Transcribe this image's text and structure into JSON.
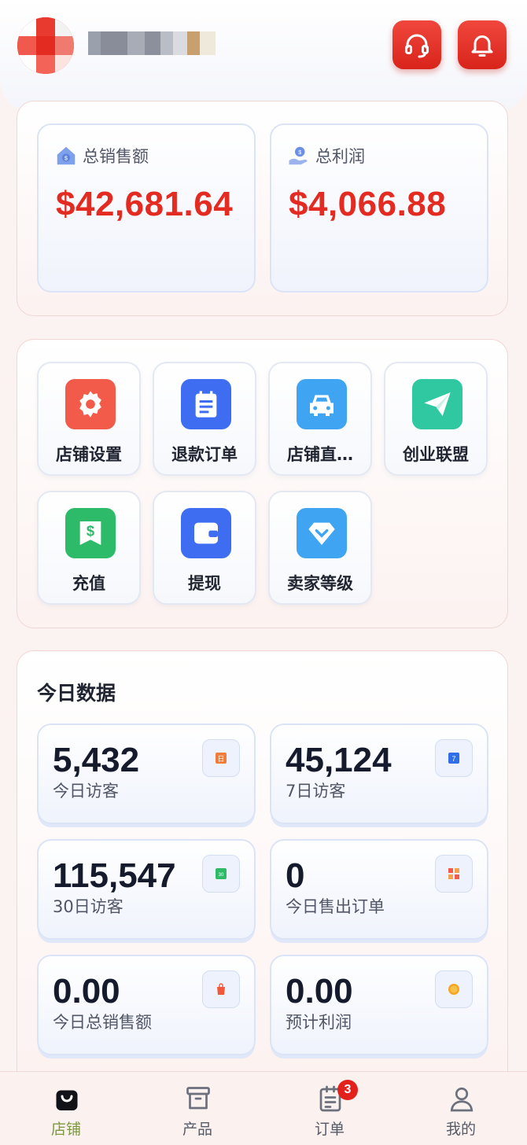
{
  "header": {
    "support_icon": "headset-icon",
    "notification_icon": "bell-icon",
    "brand_color": "#e32b22"
  },
  "summary": {
    "total_sales_label": "总销售额",
    "total_sales_value": "$42,681.64",
    "total_profit_label": "总利润",
    "total_profit_value": "$4,066.88"
  },
  "menu": {
    "items": [
      {
        "label": "店铺设置",
        "icon": "gear-icon",
        "color": "#f25a4a"
      },
      {
        "label": "退款订单",
        "icon": "clipboard-icon",
        "color": "#3f6df2"
      },
      {
        "label": "店铺直…",
        "icon": "car-icon",
        "color": "#3fa4f2"
      },
      {
        "label": "创业联盟",
        "icon": "paper-plane-icon",
        "color": "#2fc8a0"
      },
      {
        "label": "充值",
        "icon": "dollar-bag-icon",
        "color": "#2dbb6a"
      },
      {
        "label": "提现",
        "icon": "wallet-icon",
        "color": "#3f6df2"
      },
      {
        "label": "卖家等级",
        "icon": "diamond-icon",
        "color": "#3fa4f2"
      }
    ]
  },
  "today": {
    "title": "今日数据",
    "kpis": [
      {
        "value": "5,432",
        "caption": "今日访客",
        "mini_text": "日"
      },
      {
        "value": "45,124",
        "caption": "7日访客",
        "mini_text": "7"
      },
      {
        "value": "115,547",
        "caption": "30日访客",
        "mini_text": "30"
      },
      {
        "value": "0",
        "caption": "今日售出订单"
      },
      {
        "value": "0.00",
        "caption": "今日总销售额"
      },
      {
        "value": "0.00",
        "caption": "预计利润"
      }
    ]
  },
  "nav": {
    "items": [
      {
        "label": "店铺",
        "icon": "shopping-bag-icon",
        "active": true
      },
      {
        "label": "产品",
        "icon": "archive-box-icon"
      },
      {
        "label": "订单",
        "icon": "order-list-icon",
        "badge": "3"
      },
      {
        "label": "我的",
        "icon": "user-icon"
      }
    ]
  }
}
